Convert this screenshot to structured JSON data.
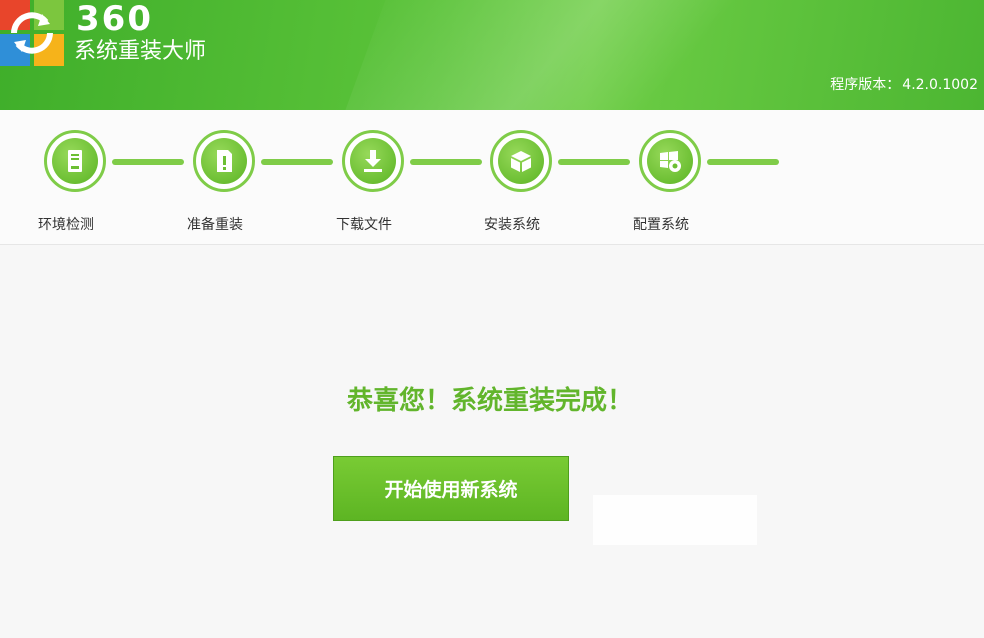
{
  "header": {
    "brand_number": "360",
    "brand_name": "系统重装大师",
    "version_label": "程序版本：",
    "version_value": "4.2.0.1002",
    "colors": {
      "primary_green": "#4cb632",
      "accent_green": "#6dcd45"
    }
  },
  "steps": [
    {
      "label": "环境检测",
      "icon": "computer-tower-icon"
    },
    {
      "label": "准备重装",
      "icon": "document-exclamation-icon"
    },
    {
      "label": "下载文件",
      "icon": "download-arrow-icon"
    },
    {
      "label": "安装系统",
      "icon": "install-package-icon"
    },
    {
      "label": "配置系统",
      "icon": "windows-gear-icon"
    }
  ],
  "main": {
    "message": "恭喜您！系统重装完成！",
    "start_button_label": "开始使用新系统",
    "colors": {
      "message_green": "#62b52c",
      "button_green": "#6cc12c"
    }
  }
}
